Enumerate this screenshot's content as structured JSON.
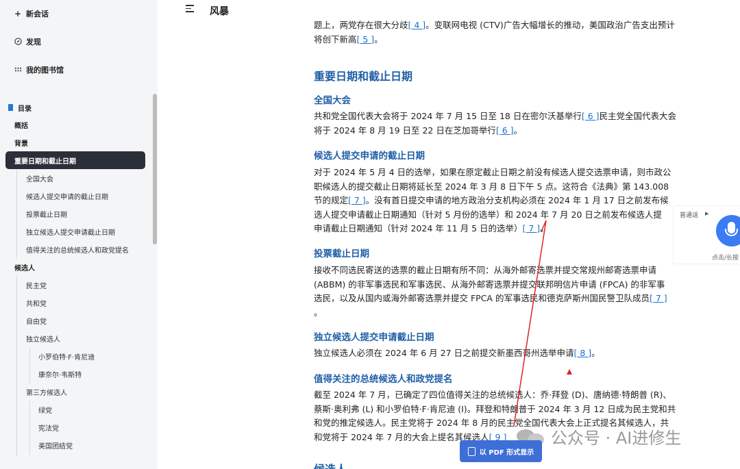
{
  "sidebar": {
    "new_chat": "新会话",
    "discover": "发现",
    "library": "我的图书馆",
    "toc_title": "目录",
    "toc": [
      {
        "label": "概括",
        "level": 1
      },
      {
        "label": "背景",
        "level": 1
      },
      {
        "label": "重要日期和截止日期",
        "level": 1,
        "active": true
      },
      {
        "label": "全国大会",
        "level": 2
      },
      {
        "label": "候选人提交申请的截止日期",
        "level": 2
      },
      {
        "label": "投票截止日期",
        "level": 2
      },
      {
        "label": "独立候选人提交申请截止日期",
        "level": 2
      },
      {
        "label": "值得关注的总统候选人和政党提名",
        "level": 2
      },
      {
        "label": "候选人",
        "level": 1
      },
      {
        "label": "民主党",
        "level": 2
      },
      {
        "label": "共和党",
        "level": 2
      },
      {
        "label": "自由党",
        "level": 2
      },
      {
        "label": "独立候选人",
        "level": 2
      },
      {
        "label": "小罗伯特·F·肯尼迪",
        "level": 3
      },
      {
        "label": "康奈尔·韦斯特",
        "level": 3
      },
      {
        "label": "第三方候选人",
        "level": 2
      },
      {
        "label": "绿党",
        "level": 3
      },
      {
        "label": "宪法党",
        "level": 3
      },
      {
        "label": "美国团结党",
        "level": 3
      }
    ]
  },
  "header": {
    "title": "风暴"
  },
  "content": {
    "top_line1": "题上，两党存在很大分歧",
    "top_ref1": "[ 4 ]",
    "top_line1b": "。变联网电视 (CTV)广告大幅增长的推动，美国政治广告支出预计",
    "top_line2": "将创下新高",
    "top_ref2": "[ 5 ]",
    "top_line2b": "。",
    "h2_dates": "重要日期和截止日期",
    "h3_convention": "全国大会",
    "p_convention": [
      "共和党全国代表大会将于 2024 年 7 月 15 日至 18 日在密尔沃基举行",
      "[ 6 ]",
      "民主党全国代表大会",
      "将于 2024 年 8 月 19 日至 22 日在芝加哥举行",
      "[ 6 ]",
      "。"
    ],
    "h3_filing": "候选人提交申请的截止日期",
    "p_filing": [
      "对于 2024 年 5 月 4 日的选举，如果在原定截止日期之前没有候选人提交选票申请，则市政公",
      "职候选人的提交截止日期将延长至 2024 年 3 月 8 日下午 5 点。这符合《法典》第 143.008",
      "节的规定",
      "[ 7 ]",
      "。没有首日提交申请的地方政治分支机构必须在 2024 年 1 月 17 日之前发布候",
      "选人提交申请截止日期通知（针对 5 月份的选举）和 2024 年 7 月 20 日之前发布候选人提",
      "申请截止日期通知（针对 2024 年 11 月 5 日的选举）",
      "[ 7 ]",
      "。"
    ],
    "h3_voting": "投票截止日期",
    "p_voting": [
      "接收不同选民寄送的选票的截止日期有所不同：从海外邮寄选票并提交常规州邮寄选票申请",
      "(ABBM) 的非军事选民和军事选民、从海外邮寄选票并提交联邦明信片申请 (FPCA) 的非军事",
      "选民，以及从国内或海外邮寄选票并提交 FPCA 的军事选民和德克萨斯州国民警卫队成员",
      "[ 7 ]",
      "。"
    ],
    "h3_independent": "独立候选人提交申请截止日期",
    "p_independent": [
      "独立候选人必须在 2024 年 6 月 27 日之前提交新墨西哥州选举申请",
      "[ 8 ]",
      "。"
    ],
    "h3_notable": "值得关注的总统候选人和政党提名",
    "p_notable": [
      "截至 2024 年 7 月，已确定了四位值得关注的总统候选人：乔·拜登 (D)、唐纳德·特朗普 (R)、",
      "蔡斯·奥利弗 (L) 和小罗伯特·F·肯尼迪 (I)。拜登和特朗普于 2024 年 3 月 12 日成为民主党和共",
      "和党的推定候选人。民主党将于 2024 年 8 月的民主党全国代表大会上正式提名其候选人，共",
      "和党将于 2024 年 7 月的大会上提名其候选人",
      "[ 9 ]"
    ],
    "bottom_heading_partial": "候选人"
  },
  "voice_widget": {
    "label": "普通话",
    "hint": "点击/长按"
  },
  "pdf_button": {
    "label": "以 PDF 形式显示"
  },
  "watermark": {
    "text": "公众号 · AI进修生"
  },
  "colors": {
    "accent": "#1f5fa6",
    "link": "#1a6fd0",
    "active_bg": "#2b2f3a",
    "button": "#3d6fd6",
    "annotation": "#e02020"
  }
}
